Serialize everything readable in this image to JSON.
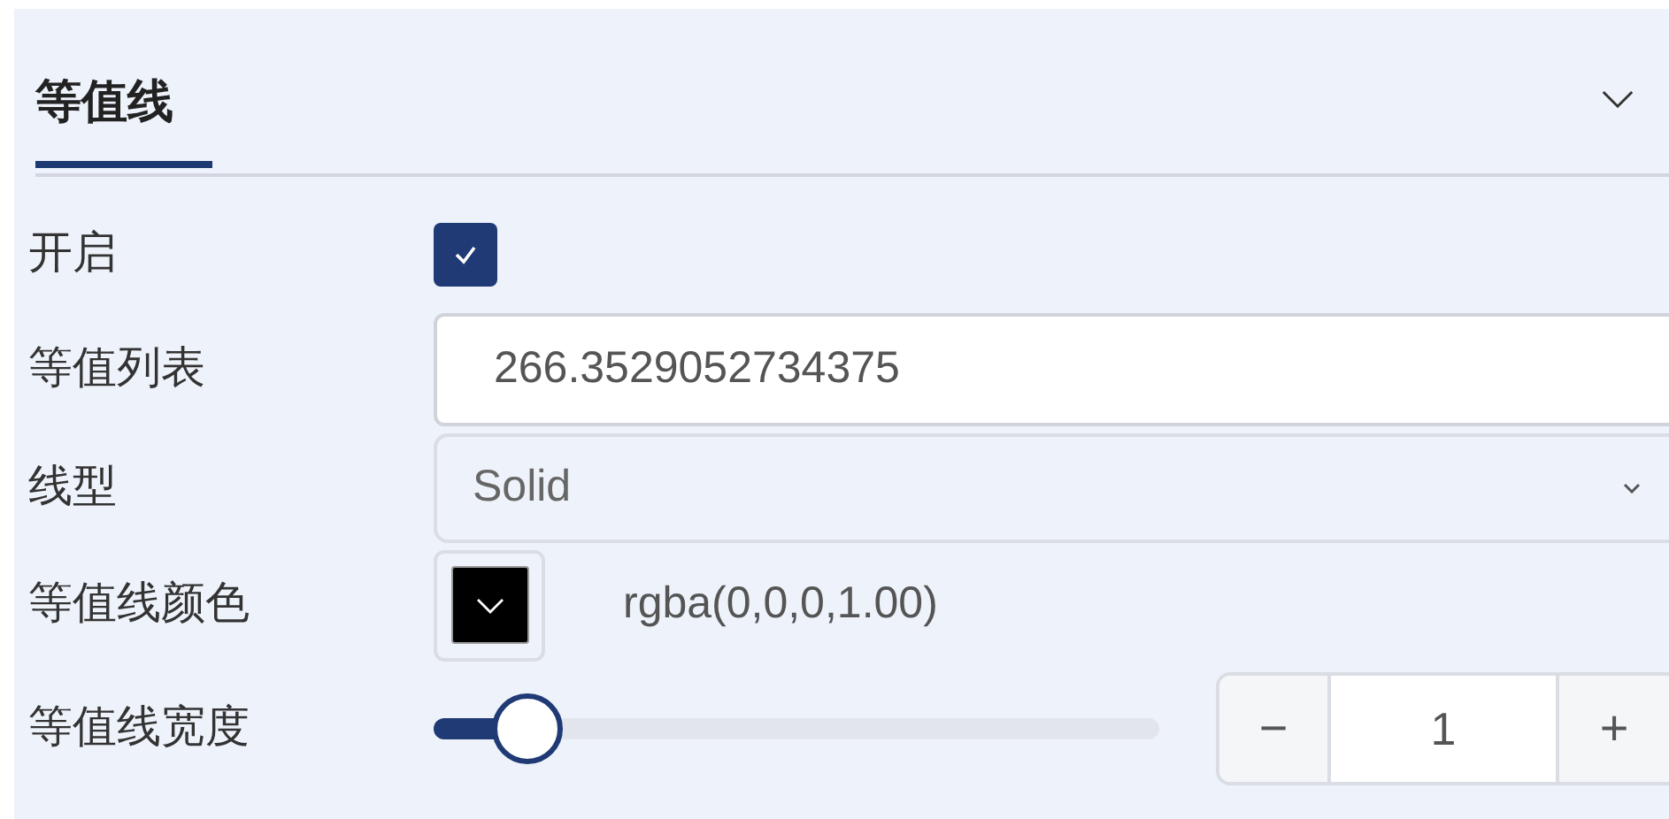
{
  "panel": {
    "title": "等值线",
    "tab_selected": true,
    "expanded": true
  },
  "rows": [
    {
      "kind": "checkbox",
      "label": "开启",
      "checked": true
    },
    {
      "kind": "input",
      "label": "等值列表",
      "value": "266.3529052734375"
    },
    {
      "kind": "select",
      "label": "线型",
      "value": "Solid"
    },
    {
      "kind": "color",
      "label": "等值线颜色",
      "color": "#000000",
      "value": "rgba(0,0,0,1.00)"
    },
    {
      "kind": "slider",
      "label": "等值线宽度",
      "level": 0.13,
      "minus": "−",
      "value": "1",
      "plus": "+"
    }
  ]
}
